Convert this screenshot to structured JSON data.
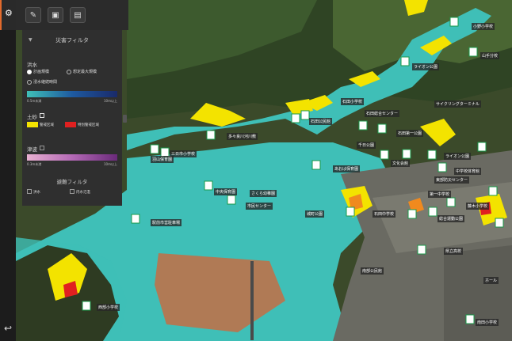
{
  "panel": {
    "title": "災害フィルタ",
    "flood": {
      "label": "洪水",
      "options": [
        "計画規模",
        "想定最大規模",
        "浸水継続時間"
      ],
      "scale": [
        "0.5m未満",
        "10m以上"
      ]
    },
    "landslide": {
      "label": "土砂",
      "items": [
        "警戒区域",
        "特別警戒区域"
      ]
    },
    "tsunami": {
      "label": "津波",
      "scale": [
        "0.3m未満",
        "10m以上"
      ]
    },
    "shelter": {
      "label": "避難フィルタ",
      "items": [
        "洪水",
        "内水氾濫"
      ]
    }
  },
  "colors": {
    "flood": "#3fbfb7",
    "land": "#f3e300",
    "landRed": "#e02020",
    "tsunami": "#b469b6"
  },
  "map_labels": {
    "l1": "三日市小学校",
    "l2": "羽山保育園",
    "l3": "さくら幼稚園",
    "l4": "石田小学校",
    "l5": "石田中学校",
    "l6": "石田公民館",
    "l7": "石田総合センター",
    "l8": "多々良川河川敷",
    "l9": "千日公園",
    "l10": "石田第一公園",
    "l11": "あおば保育園",
    "l12": "文化会館",
    "l13": "中学校体育館",
    "l14": "県営住宅前",
    "l15": "藤木小学校",
    "l16": "総合運動公園",
    "l17": "東部防災センター",
    "l18": "第一中学校",
    "l19": "城町公園",
    "l20": "市民センター",
    "l21": "八幡小学校",
    "l22": "中央保育園",
    "l23": "国立研究所",
    "l24": "南部公民館",
    "l25": "緑地公園",
    "l26": "海浜広場",
    "l27": "西部小学校",
    "l28": "南田小学校",
    "l29": "駅前市営駐車場",
    "l30": "県立高校",
    "l31": "東中学校",
    "l32": "ホール",
    "l33": "港湾施設",
    "l34": "北山小学校",
    "l35": "ライオン公園",
    "l36": "大谷川公園",
    "l37": "サイクリングターミナル",
    "l38": "山手分校",
    "l39": "小野小学校",
    "l40": "広域避難場所"
  }
}
